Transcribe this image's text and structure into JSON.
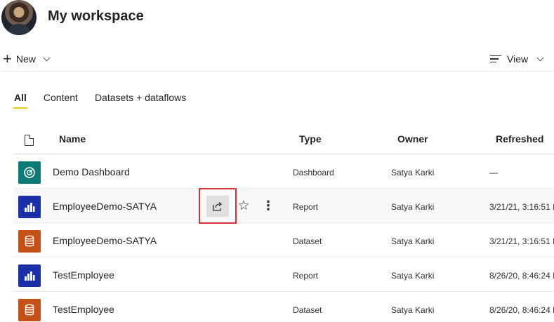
{
  "header": {
    "title": "My workspace"
  },
  "commandbar": {
    "new_label": "New",
    "view_label": "View"
  },
  "tabs": [
    {
      "label": "All",
      "active": true
    },
    {
      "label": "Content",
      "active": false
    },
    {
      "label": "Datasets + dataflows",
      "active": false
    }
  ],
  "table": {
    "columns": {
      "name": "Name",
      "type": "Type",
      "owner": "Owner",
      "refreshed": "Refreshed"
    },
    "rows": [
      {
        "icon": "dashboard-icon",
        "color": "#0e7a75",
        "name": "Demo Dashboard",
        "type": "Dashboard",
        "owner": "Satya Karki",
        "refreshed": "—"
      },
      {
        "icon": "report-icon",
        "color": "#1b2fa6",
        "name": "EmployeeDemo-SATYA",
        "type": "Report",
        "owner": "Satya Karki",
        "refreshed": "3/21/21, 3:16:51 P"
      },
      {
        "icon": "dataset-icon",
        "color": "#c4511a",
        "name": "EmployeeDemo-SATYA",
        "type": "Dataset",
        "owner": "Satya Karki",
        "refreshed": "3/21/21, 3:16:51 P"
      },
      {
        "icon": "report-icon",
        "color": "#1b2fa6",
        "name": "TestEmployee",
        "type": "Report",
        "owner": "Satya Karki",
        "refreshed": "8/26/20, 8:46:24 P"
      },
      {
        "icon": "dataset-icon",
        "color": "#c4511a",
        "name": "TestEmployee",
        "type": "Dataset",
        "owner": "Satya Karki",
        "refreshed": "8/26/20, 8:46:24 P"
      }
    ]
  },
  "row_actions": {
    "share_icon": "share-icon",
    "favorite_icon": "star-icon",
    "more_icon": "more-options-icon"
  },
  "colors": {
    "tab_underline": "#f2c811",
    "highlight_border": "#d13438"
  }
}
